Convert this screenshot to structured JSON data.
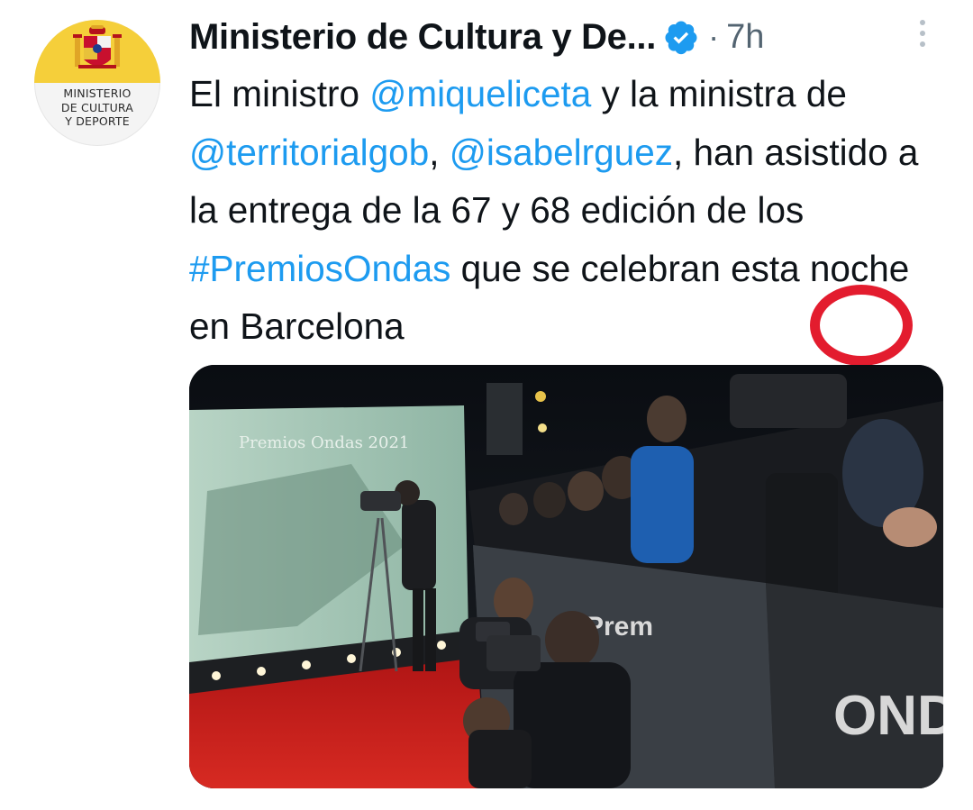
{
  "account": {
    "display_name": "Ministerio de Cultura y De...",
    "time_ago": "7h",
    "separator": "·",
    "avatar_lines": [
      "MINISTERIO",
      "DE CULTURA",
      "Y DEPORTE"
    ]
  },
  "tweet": {
    "segments": [
      {
        "text": "El ministro ",
        "kind": "plain"
      },
      {
        "text": "@miqueliceta",
        "kind": "mention"
      },
      {
        "text": " y la ministra de ",
        "kind": "plain"
      },
      {
        "text": "@territorialgob",
        "kind": "mention"
      },
      {
        "text": ", ",
        "kind": "plain"
      },
      {
        "text": "@isabelrguez",
        "kind": "mention"
      },
      {
        "text": ", han asistido a la entrega de la 67 y 68 edición de los ",
        "kind": "plain"
      },
      {
        "text": "#PremiosOndas",
        "kind": "hashtag"
      },
      {
        "text": " que se celebran esta noche en Barcelona",
        "kind": "plain"
      }
    ]
  },
  "media": {
    "backdrop_title": "Premios Ondas 2021",
    "fence_sign": "ONDA",
    "fence_brand": "Prem"
  },
  "icons": {
    "verified": "verified-badge-icon",
    "more": "more-vertical-icon"
  },
  "colors": {
    "link": "#1d9bf0",
    "secondary_text": "#536471",
    "verified": "#1d9bf0",
    "annotation": "#e31c2e",
    "carpet": "#c41d1d"
  }
}
